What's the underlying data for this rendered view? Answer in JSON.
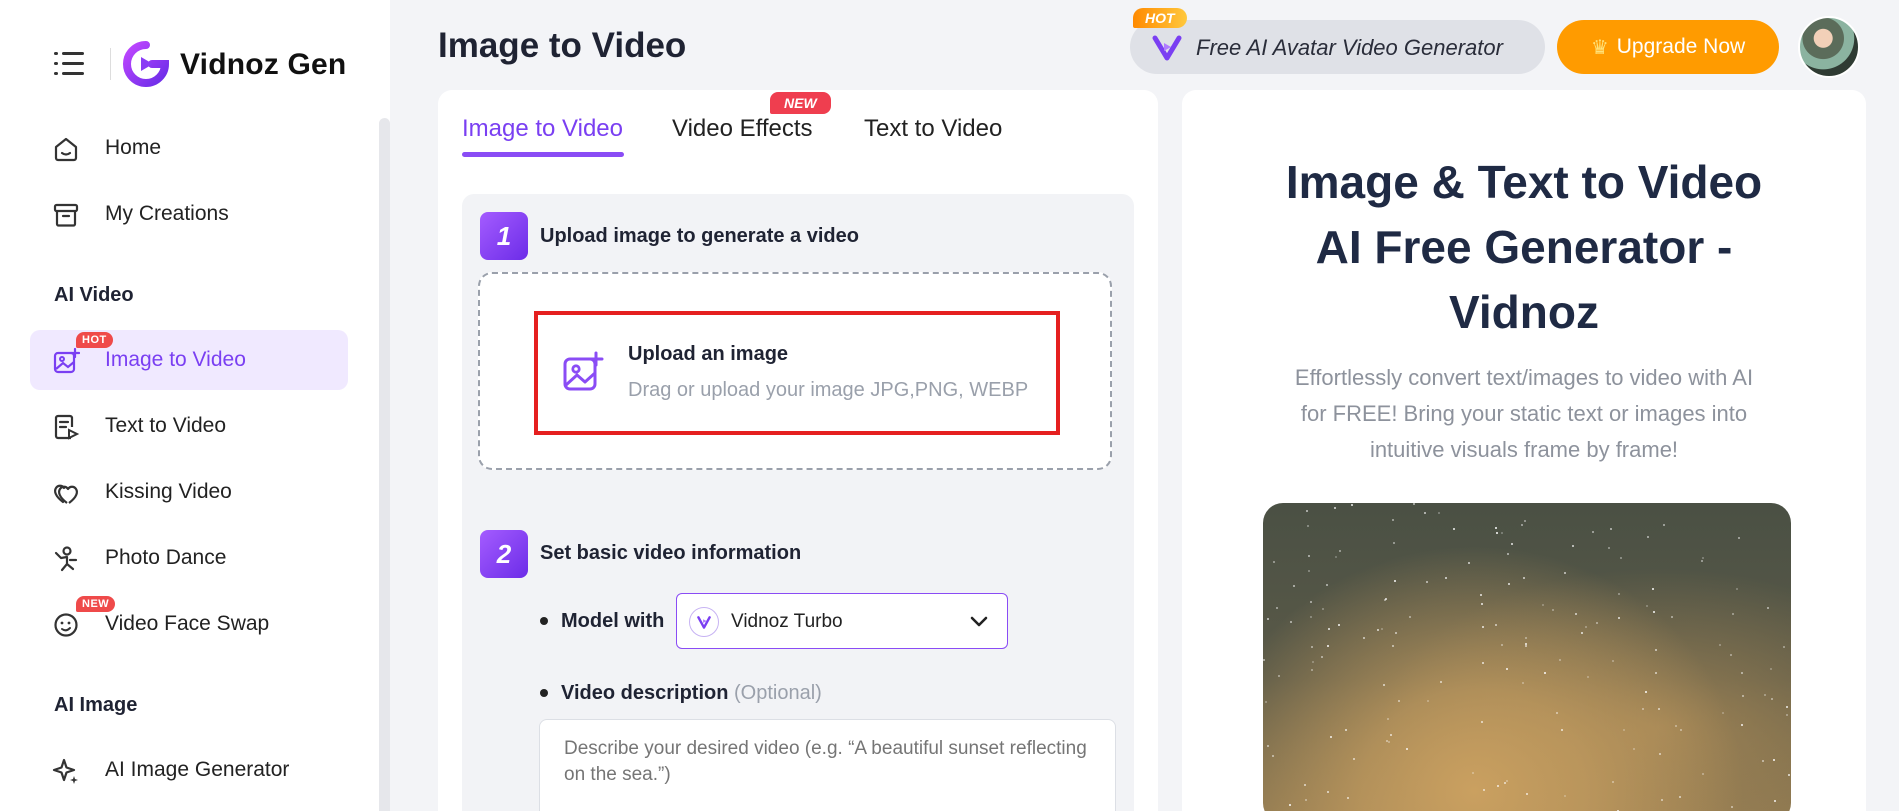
{
  "app": {
    "logo_text": "Vidnoz Gen",
    "accent": "#7a3ff2",
    "brand_orange": "#ff9b00"
  },
  "sidebar": {
    "items_top": [
      {
        "label": "Home",
        "icon": "home-icon"
      },
      {
        "label": "My Creations",
        "icon": "archive-icon"
      }
    ],
    "section_video": "AI Video",
    "items_video": [
      {
        "label": "Image to Video",
        "icon": "image-plus-icon",
        "badge": "HOT",
        "active": true
      },
      {
        "label": "Text to Video",
        "icon": "doc-play-icon"
      },
      {
        "label": "Kissing Video",
        "icon": "hearts-icon"
      },
      {
        "label": "Photo Dance",
        "icon": "dance-icon"
      },
      {
        "label": "Video Face Swap",
        "icon": "face-swap-icon",
        "badge": "NEW"
      }
    ],
    "section_image": "AI Image",
    "items_image": [
      {
        "label": "AI Image Generator",
        "icon": "sparkle-icon"
      }
    ]
  },
  "header": {
    "title": "Image to Video",
    "promo_badge": "HOT",
    "promo_text": "Free AI Avatar Video Generator",
    "upgrade_label": "Upgrade Now"
  },
  "tabs": [
    {
      "label": "Image to Video",
      "active": true
    },
    {
      "label": "Video Effects",
      "badge": "NEW"
    },
    {
      "label": "Text to Video"
    }
  ],
  "step1": {
    "number": "1",
    "title": "Upload image to generate a video",
    "upload_title": "Upload an image",
    "upload_sub": "Drag or upload your image JPG,PNG, WEBP"
  },
  "step2": {
    "number": "2",
    "title": "Set basic video information",
    "model_label": "Model with",
    "model_value": "Vidnoz Turbo",
    "desc_label": "Video description",
    "desc_optional": "(Optional)",
    "desc_placeholder": "Describe your desired video (e.g. “A beautiful sunset reflecting on the sea.”)"
  },
  "hero": {
    "title_lines": [
      "Image & Text to Video",
      "AI Free Generator -",
      "Vidnoz"
    ],
    "subtitle_lines": [
      "Effortlessly convert text/images to video with AI",
      "for FREE! Bring your static text or images into",
      "intuitive visuals frame by frame!"
    ]
  }
}
